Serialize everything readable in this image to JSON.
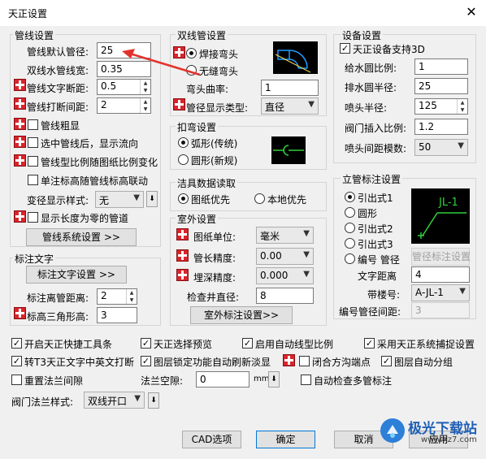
{
  "window": {
    "title": "天正设置",
    "close_glyph": "✕"
  },
  "pipe_settings": {
    "title": "管线设置",
    "default_diameter": {
      "label": "管线默认管径:",
      "value": "25"
    },
    "double_width": {
      "label": "双线水管线宽:",
      "value": "0.35"
    },
    "text_break": {
      "label": "管线文字断距:",
      "value": "0.5"
    },
    "break_gap": {
      "label": "管线打断间距:",
      "value": "2"
    },
    "bold": {
      "label": "管线粗显"
    },
    "show_flow": {
      "label": "选中管线后，显示流向"
    },
    "scale_with_drawing": {
      "label": "管线型比例随图纸比例变化"
    },
    "single_link": {
      "label": "单注标高随管线标高联动"
    },
    "reducer_style": {
      "label": "变径显示样式:",
      "value": "无",
      "button_glyph": "⬇"
    },
    "zero_length": {
      "label": "显示长度为零的管道"
    },
    "system_button": "管线系统设置 >>"
  },
  "label_text": {
    "title": "标注文字",
    "text_button": "标注文字设置 >>",
    "distance": {
      "label": "标注离管距离:",
      "value": "2"
    },
    "triangle": {
      "label": "标高三角形高:",
      "value": "3"
    }
  },
  "double_pipe": {
    "title": "双线管设置",
    "weld_elbow": "焊接弯头",
    "seamless_elbow": "无缝弯头",
    "radius": {
      "label": "弯头曲率:",
      "value": "1"
    },
    "display_type": {
      "label": "管径显示类型:",
      "value": "直径"
    }
  },
  "bend": {
    "title": "扣弯设置",
    "arc": "弧形(传统)",
    "circle": "圆形(新规)"
  },
  "fixture": {
    "title": "洁具数据读取",
    "drawing_first": "图纸优先",
    "local_first": "本地优先"
  },
  "outdoor": {
    "title": "室外设置",
    "unit": {
      "label": "图纸单位:",
      "value": "毫米"
    },
    "length_precision": {
      "label": "管长精度:",
      "value": "0.00"
    },
    "depth_precision": {
      "label": "埋深精度:",
      "value": "0.000"
    },
    "well_diameter": {
      "label": "检查井直径:",
      "value": "8"
    },
    "label_button": "室外标注设置>>"
  },
  "equipment": {
    "title": "设备设置",
    "support_3d": "天正设备支持3D",
    "supply_ratio": {
      "label": "给水圆比例:",
      "value": "1"
    },
    "drain_radius": {
      "label": "排水圆半径:",
      "value": "25"
    },
    "nozzle_radius": {
      "label": "喷头半径:",
      "value": "125"
    },
    "valve_ratio": {
      "label": "阀门插入比例:",
      "value": "1.2"
    },
    "nozzle_modulus": {
      "label": "喷头间距模数:",
      "value": "50"
    }
  },
  "riser": {
    "title": "立管标注设置",
    "options": [
      "引出式1",
      "圆形",
      "引出式2",
      "引出式3"
    ],
    "number_pipe_diameter": "编号 管径",
    "diameter_button": "管径标注设置",
    "preview_label": "JL-1",
    "text_distance": {
      "label": "文字距离",
      "value": "4"
    },
    "floor_number": {
      "label": "带楼号:",
      "value": "A-JL-1"
    },
    "number_spacing": {
      "label": "编号管径间距:",
      "value": "3"
    }
  },
  "options": {
    "shortcut_toolbar": "开启天正快捷工具条",
    "select_preview": "天正选择预览",
    "auto_linetype": "启用自动线型比例",
    "object_snap": "采用天正系统捕捉设置",
    "t3_text_break": "转T3天正文字中英文打断",
    "layer_lock": "图层锁定功能自动刷新淡显",
    "close_endpoint": "闭合方沟端点",
    "auto_layer": "图层自动分组",
    "reset_flange": "重置法兰间隙",
    "flange_gap": {
      "label": "法兰空隙:",
      "value": "0",
      "unit": "mm",
      "button_glyph": "⬇"
    },
    "multi_pipe_check": "自动检查多管标注",
    "valve_flange_style": {
      "label": "阀门法兰样式:",
      "value": "双线开口",
      "button_glyph": "⬇"
    }
  },
  "footer": {
    "cad_options": "CAD选项",
    "ok": "确定",
    "cancel": "取消",
    "apply": "应用"
  },
  "watermark": {
    "text": "极光下载站",
    "url": "www.xz7.com"
  },
  "colors": {
    "annotation_arrow": "#e3322b",
    "accent": "#d9242b",
    "preview_line": "#2fd13b"
  }
}
